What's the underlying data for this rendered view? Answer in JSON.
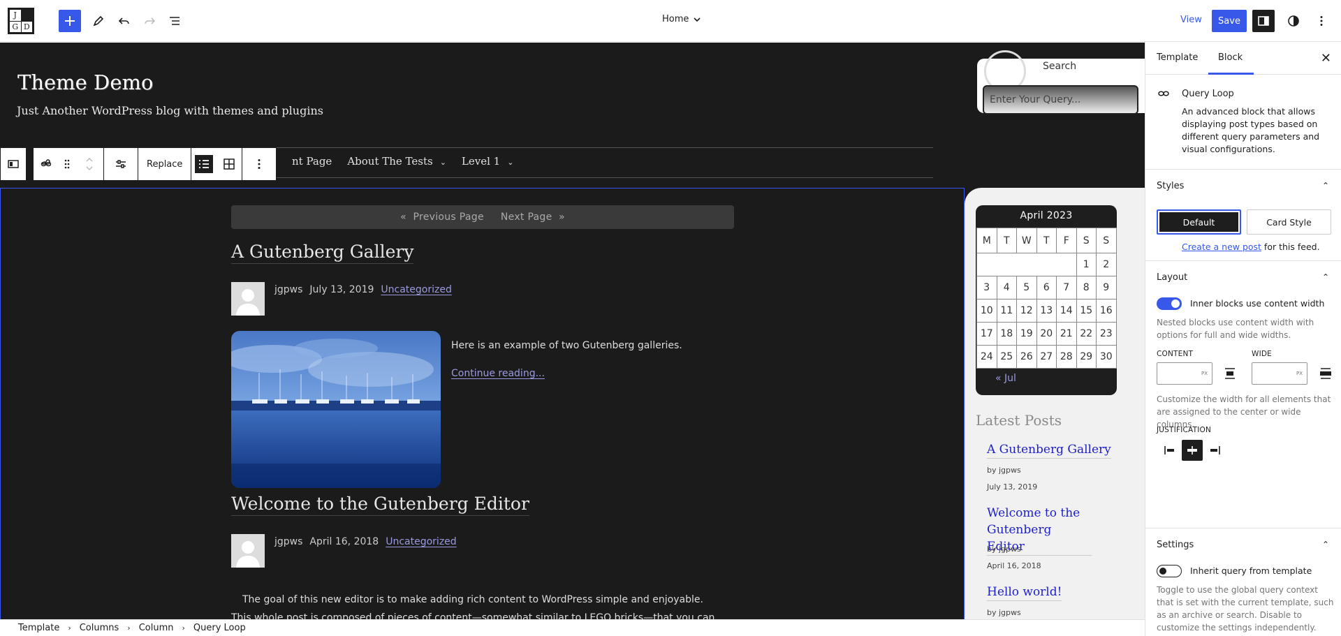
{
  "topbar": {
    "logo_letters": [
      "J",
      "",
      "G",
      "D"
    ],
    "document_title": "Home",
    "view_label": "View",
    "save_label": "Save"
  },
  "canvas": {
    "site_title": "Theme Demo",
    "site_tagline": "Just Another WordPress blog with themes and plugins",
    "nav": [
      "nt Page",
      "About The Tests",
      "Level 1"
    ],
    "block_toolbar": {
      "replace_label": "Replace"
    },
    "pagination": {
      "prev": "Previous Page",
      "next": "Next Page"
    },
    "posts": [
      {
        "title": "A Gutenberg Gallery",
        "author": "jgpws",
        "date": "July 13, 2019",
        "category": "Uncategorized",
        "excerpt": "Here is an example of two Gutenberg galleries.",
        "continue": "Continue reading..."
      },
      {
        "title": "Welcome to the Gutenberg Editor",
        "author": "jgpws",
        "date": "April 16, 2018",
        "category": "Uncategorized",
        "body_1": "The goal of this new editor is to make adding rich content to WordPress simple and enjoyable.",
        "body_2": "This whole post is composed of pieces of content—somewhat similar to LEGO bricks—that you can"
      }
    ],
    "search": {
      "label": "Search",
      "placeholder": "Enter Your Query..."
    },
    "calendar": {
      "caption": "April 2023",
      "weekdays": [
        "M",
        "T",
        "W",
        "T",
        "F",
        "S",
        "S"
      ],
      "rows": [
        [
          "",
          "",
          "",
          "",
          "",
          "1",
          "2"
        ],
        [
          "3",
          "4",
          "5",
          "6",
          "7",
          "8",
          "9"
        ],
        [
          "10",
          "11",
          "12",
          "13",
          "14",
          "15",
          "16"
        ],
        [
          "17",
          "18",
          "19",
          "20",
          "21",
          "22",
          "23"
        ],
        [
          "24",
          "25",
          "26",
          "27",
          "28",
          "29",
          "30"
        ]
      ],
      "prev_link": "« Jul"
    },
    "latest_posts": {
      "title": "Latest Posts",
      "items": [
        {
          "title": "A Gutenberg Gallery",
          "author": "by jgpws",
          "date": "July 13, 2019"
        },
        {
          "title": "Welcome to the Gutenberg Editor",
          "author": "by jgpws",
          "date": "April 16, 2018"
        },
        {
          "title": "Hello world!",
          "author": "by jgpws",
          "date": ""
        }
      ]
    }
  },
  "breadcrumbs": [
    "Template",
    "Columns",
    "Column",
    "Query Loop"
  ],
  "panel": {
    "tabs": [
      "Template",
      "Block"
    ],
    "active_tab": "Block",
    "block_name": "Query Loop",
    "block_description": "An advanced block that allows displaying post types based on different query parameters and visual configurations.",
    "styles": {
      "heading": "Styles",
      "options": [
        "Default",
        "Card Style"
      ],
      "selected": "Default",
      "create_link": "Create a new post",
      "create_suffix": " for this feed."
    },
    "layout": {
      "heading": "Layout",
      "toggle_label": "Inner blocks use content width",
      "toggle_on": true,
      "toggle_help": "Nested blocks use content width with options for full and wide widths.",
      "content_label": "CONTENT",
      "wide_label": "WIDE",
      "unit": "PX",
      "width_help": "Customize the width for all elements that are assigned to the center or wide columns.",
      "justification_label": "JUSTIFICATION",
      "justification_selected": "center"
    },
    "settings": {
      "heading": "Settings",
      "toggle_label": "Inherit query from template",
      "toggle_on": false,
      "toggle_help": "Toggle to use the global query context that is set with the current template, such as an archive or search. Disable to customize the settings independently."
    }
  },
  "colors": {
    "accent": "#3858e9",
    "canvas_bg": "#1b1b1b",
    "link_purple": "#9a9ae0"
  }
}
